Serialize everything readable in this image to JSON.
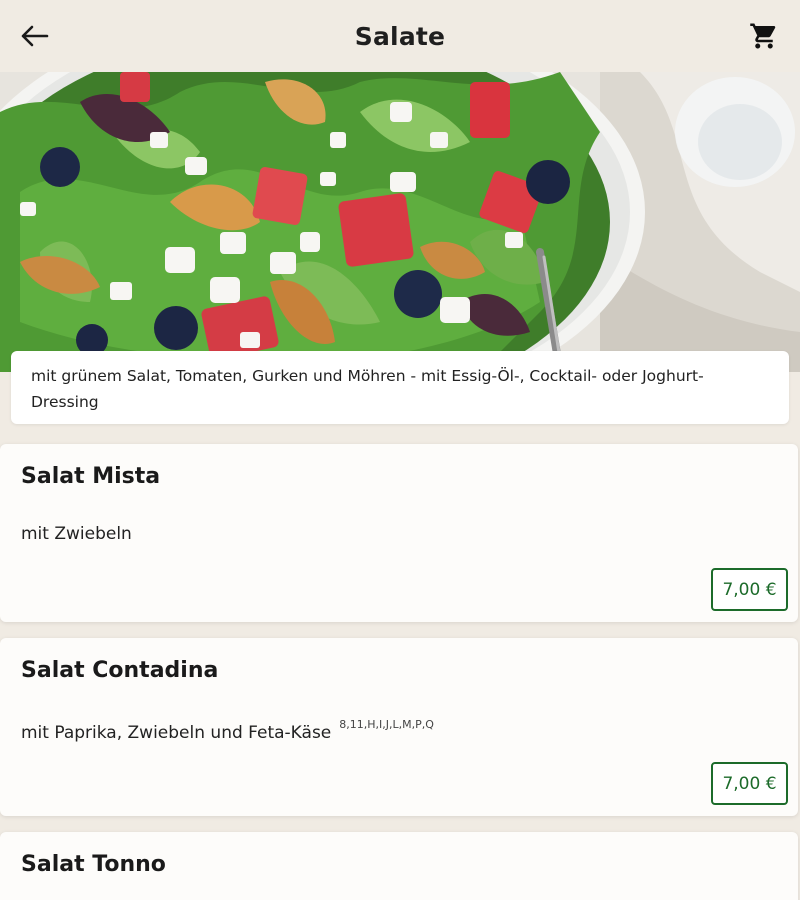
{
  "header": {
    "title": "Salate",
    "back_icon": "arrow-left-icon",
    "cart_icon": "shopping-cart-icon"
  },
  "category": {
    "description": "mit grünem Salat, Tomaten, Gurken und Möhren - mit Essig-Öl-, Cocktail- oder Joghurt-Dressing"
  },
  "items": [
    {
      "name": "Salat Mista",
      "description": "mit Zwiebeln",
      "allergens": "",
      "price": "7,00 €"
    },
    {
      "name": "Salat Contadina",
      "description": "mit Paprika, Zwiebeln und Feta-Käse",
      "allergens": "8,11,H,I,J,L,M,P,Q",
      "price": "7,00 €"
    },
    {
      "name": "Salat Tonno",
      "description": "",
      "allergens": "",
      "price": ""
    }
  ],
  "colors": {
    "background": "#f0ebe3",
    "accent_green": "#1c6b2a",
    "card": "#fdfcfa"
  }
}
